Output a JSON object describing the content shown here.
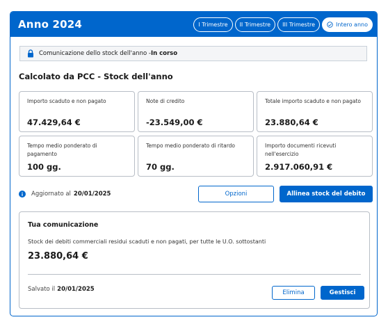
{
  "header": {
    "title": "Anno 2024",
    "tabs": [
      {
        "label": "I Trimestre"
      },
      {
        "label": "II Trimestre"
      },
      {
        "label": "III Trimestre"
      },
      {
        "label": "Intero anno"
      }
    ],
    "active_tab": "Intero anno"
  },
  "notice": {
    "text": "Comunicazione dello stock dell'anno - ",
    "status": "In corso",
    "icon": "lock-icon"
  },
  "section": {
    "title": "Calcolato da PCC - Stock dell'anno"
  },
  "tiles": [
    {
      "label": "Importo scaduto e non pagato",
      "value": "47.429,64 €"
    },
    {
      "label": "Note di credito",
      "value": "-23.549,00 €"
    },
    {
      "label": "Totale importo scaduto e non pagato",
      "value": "23.880,64 €"
    },
    {
      "label": "Tempo medio ponderato di pagamento",
      "value": "100 gg."
    },
    {
      "label": "Tempo medio ponderato di ritardo",
      "value": "70 gg."
    },
    {
      "label": "Importo documenti ricevuti nell'esercizio",
      "value": "2.917.060,91 €"
    }
  ],
  "updated": {
    "label": "Aggiornato al",
    "date": "20/01/2025",
    "icon": "info-icon"
  },
  "actions": {
    "options_label": "Opzioni",
    "align_label": "Allinea stock del debito"
  },
  "communication": {
    "title": "Tua comunicazione",
    "description": "Stock dei debiti commerciali residui scaduti e non pagati, per tutte le U.O. sottostanti",
    "value": "23.880,64 €",
    "saved_label": "Salvato il",
    "saved_date": "20/01/2025",
    "delete_label": "Elimina",
    "manage_label": "Gestisci"
  },
  "colors": {
    "primary": "#0066cc",
    "border": "#b8bec6",
    "notice_bg": "#f4f5f7"
  }
}
